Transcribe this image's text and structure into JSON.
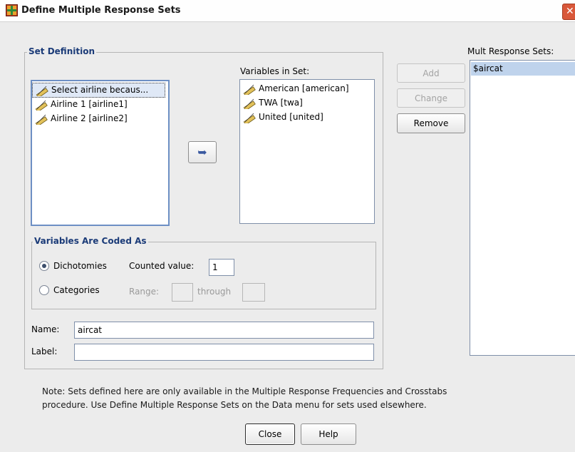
{
  "window": {
    "title": "Define Multiple Response Sets",
    "close_glyph": "✕"
  },
  "set_definition": {
    "group_title": "Set Definition",
    "source_list": {
      "items": [
        {
          "label": "Select airline becaus...",
          "icon": "ruler-variable-icon",
          "selected": true
        },
        {
          "label": "Airline 1 [airline1]",
          "icon": "ruler-variable-icon"
        },
        {
          "label": "Airline 2 [airline2]",
          "icon": "ruler-variable-icon"
        }
      ]
    },
    "move_button_glyph": "➥",
    "variables_in_set": {
      "label": "Variables in Set:",
      "items": [
        {
          "label": "American [american]",
          "icon": "ruler-variable-icon"
        },
        {
          "label": "TWA [twa]",
          "icon": "ruler-variable-icon"
        },
        {
          "label": "United [united]",
          "icon": "ruler-variable-icon"
        }
      ]
    },
    "coded_as": {
      "group_title": "Variables Are Coded As",
      "dichotomies_label": "Dichotomies",
      "dichotomies_selected": true,
      "counted_value_label": "Counted value:",
      "counted_value": "1",
      "categories_label": "Categories",
      "range_label": "Range:",
      "range_from": "",
      "through_label": "through",
      "range_to": ""
    },
    "name_label": "Name:",
    "name_value": "aircat",
    "label_label": "Label:",
    "label_value": ""
  },
  "buttons": {
    "add": "Add",
    "change": "Change",
    "remove": "Remove"
  },
  "mult_response_sets": {
    "label": "Mult Response Sets:",
    "items": [
      "$aircat"
    ]
  },
  "note": {
    "line1": "Note: Sets defined here are only available in the Multiple Response Frequencies and Crosstabs",
    "line2": "procedure. Use Define Multiple Response Sets on the Data menu for sets used elsewhere."
  },
  "footer": {
    "close": "Close",
    "help": "Help"
  },
  "colors": {
    "group_title": "#1b3b78",
    "selection": "#dfe8f6",
    "list_border": "#7f8fa9",
    "dialog_bg": "#ececec"
  }
}
